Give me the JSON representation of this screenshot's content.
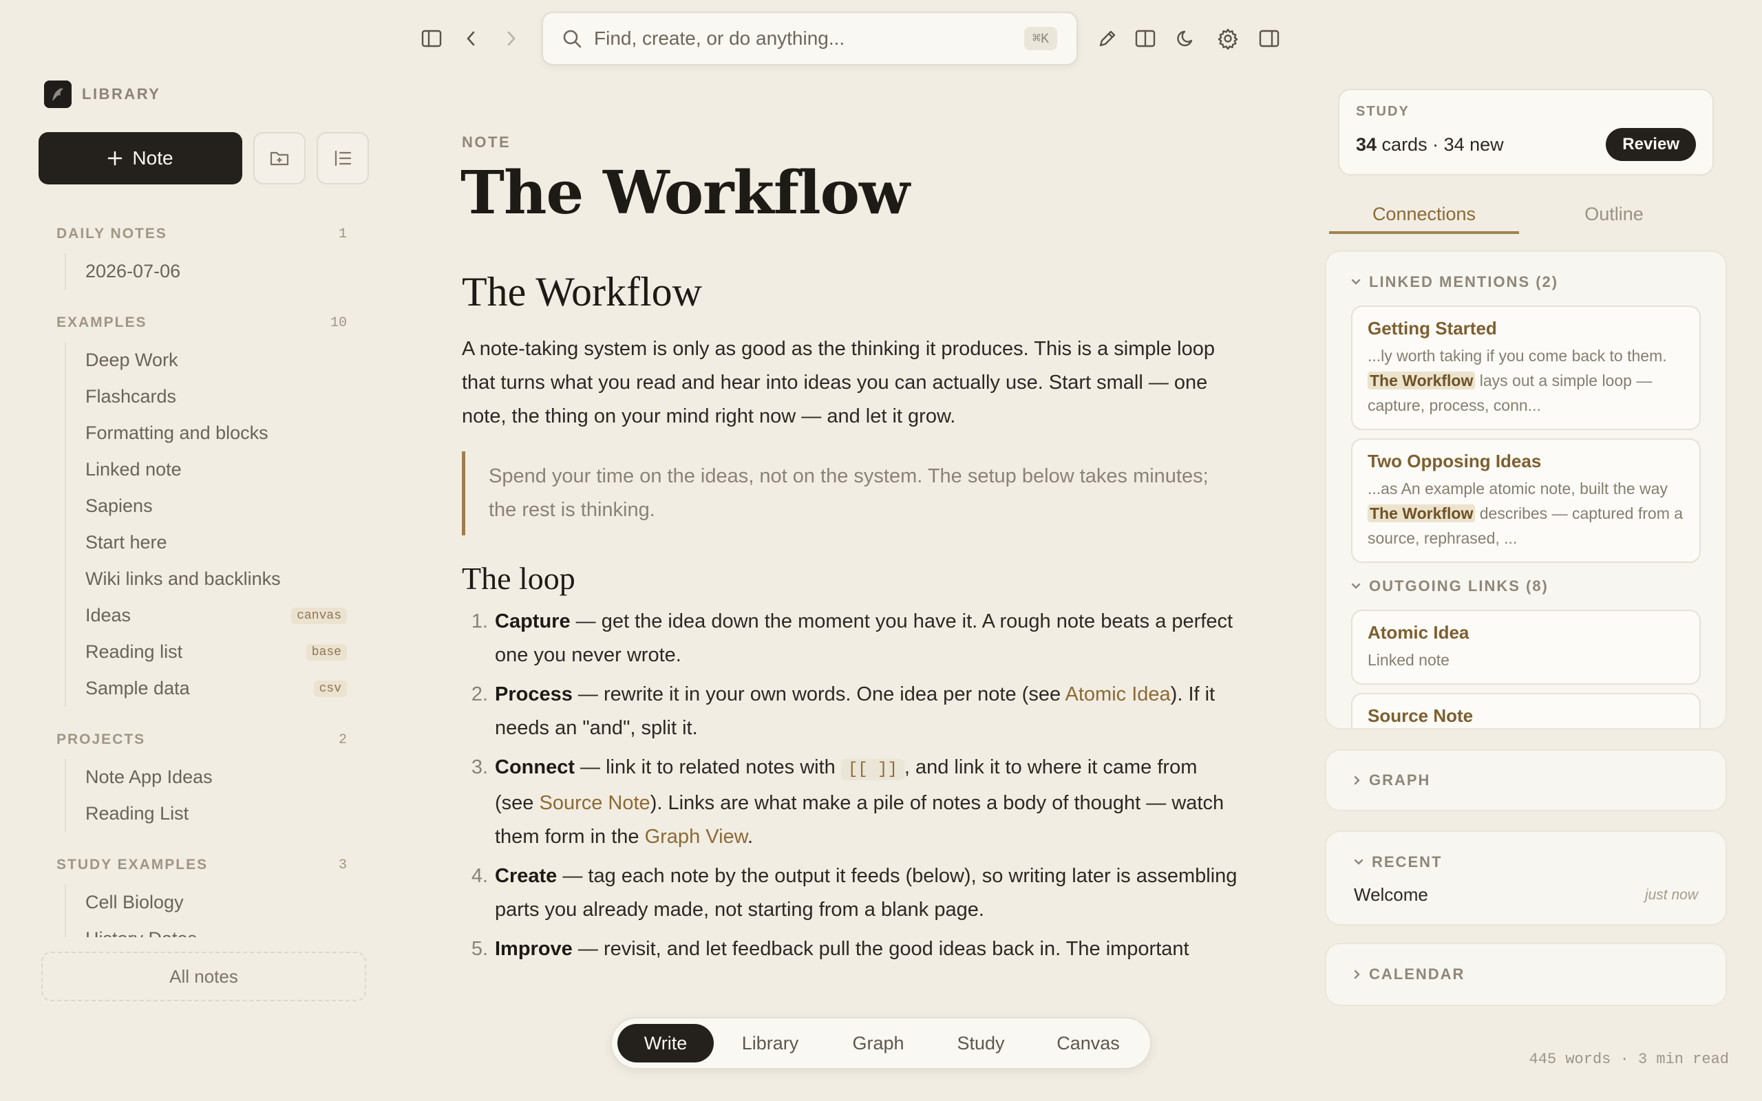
{
  "toolbar": {
    "search_placeholder": "Find, create, or do anything...",
    "search_shortcut": "⌘K",
    "icons": [
      "sidebar-toggle-icon",
      "back-arrow-icon",
      "forward-arrow-icon",
      "pencil-icon",
      "split-view-icon",
      "moon-icon",
      "gear-icon",
      "right-panel-icon"
    ]
  },
  "sidebar": {
    "title": "LIBRARY",
    "new_note_label": "Note",
    "sections": [
      {
        "title": "DAILY NOTES",
        "count": "1",
        "items": [
          {
            "label": "2026-07-06",
            "badge": ""
          }
        ]
      },
      {
        "title": "EXAMPLES",
        "count": "10",
        "items": [
          {
            "label": "Deep Work",
            "badge": ""
          },
          {
            "label": "Flashcards",
            "badge": ""
          },
          {
            "label": "Formatting and blocks",
            "badge": ""
          },
          {
            "label": "Linked note",
            "badge": ""
          },
          {
            "label": "Sapiens",
            "badge": ""
          },
          {
            "label": "Start here",
            "badge": ""
          },
          {
            "label": "Wiki links and backlinks",
            "badge": ""
          },
          {
            "label": "Ideas",
            "badge": "canvas"
          },
          {
            "label": "Reading list",
            "badge": "base"
          },
          {
            "label": "Sample data",
            "badge": "csv"
          }
        ]
      },
      {
        "title": "PROJECTS",
        "count": "2",
        "items": [
          {
            "label": "Note App Ideas",
            "badge": ""
          },
          {
            "label": "Reading List",
            "badge": ""
          }
        ]
      },
      {
        "title": "STUDY EXAMPLES",
        "count": "3",
        "items": [
          {
            "label": "Cell Biology",
            "badge": ""
          },
          {
            "label": "History Dates",
            "badge": ""
          }
        ]
      }
    ],
    "all_notes_label": "All notes"
  },
  "note": {
    "kind_label": "NOTE",
    "title": "The Workflow",
    "h2": "The Workflow",
    "intro": "A note-taking system is only as good as the thinking it produces. This is a simple loop that turns what you read and hear into ideas you can actually use. Start small — one note, the thing on your mind right now — and let it grow.",
    "quote": "Spend your time on the ideas, not on the system. The setup below takes minutes; the rest is thinking.",
    "h3": "The loop",
    "steps": {
      "s1": {
        "num": "1.",
        "term": "Capture",
        "text": " — get the idea down the moment you have it. A rough note beats a perfect one you never wrote."
      },
      "s2": {
        "num": "2.",
        "term": "Process",
        "text_a": " — rewrite it in your own words. One idea per note (see ",
        "link": "Atomic Idea",
        "text_b": "). If it needs an \"and\", split it."
      },
      "s3": {
        "num": "3.",
        "term": "Connect",
        "text_a": " — link it to related notes with ",
        "code": "[[ ]]",
        "text_b": ", and link it to where it came from (see ",
        "link1": "Source Note",
        "text_c": "). Links are what make a pile of notes a body of thought — watch them form in the ",
        "link2": "Graph View",
        "text_d": "."
      },
      "s4": {
        "num": "4.",
        "term": "Create",
        "text": " — tag each note by the output it feeds (below), so writing later is assembling parts you already made, not starting from a blank page."
      },
      "s5": {
        "num": "5.",
        "term": "Improve",
        "text": " — revisit, and let feedback pull the good ideas back in. The important"
      }
    }
  },
  "bottom_tabs": [
    "Write",
    "Library",
    "Graph",
    "Study",
    "Canvas"
  ],
  "bottom_tabs_active": "Write",
  "right": {
    "study": {
      "label": "STUDY",
      "cards": "34",
      "cards_word": " cards",
      "sep": " · ",
      "new_text": "34 new",
      "review_label": "Review"
    },
    "tabs": [
      "Connections",
      "Outline"
    ],
    "linked_mentions": {
      "title": "LINKED MENTIONS (2)",
      "items": [
        {
          "title": "Getting Started",
          "before": "...ly worth taking if you come back to them. ",
          "highlight": "The Workflow",
          "after": " lays out a simple loop — capture, process, conn..."
        },
        {
          "title": "Two Opposing Ideas",
          "before": "...as An example atomic note, built the way ",
          "highlight": "The Workflow",
          "after": " describes — captured from a source, rephrased, ..."
        }
      ]
    },
    "outgoing_links": {
      "title": "OUTGOING LINKS (8)",
      "items": [
        {
          "title": "Atomic Idea",
          "subtitle": "Linked note"
        },
        {
          "title": "Source Note",
          "subtitle": ""
        }
      ]
    },
    "graph_label": "GRAPH",
    "recent": {
      "title": "RECENT",
      "item": "Welcome",
      "time": "just now"
    },
    "calendar_label": "CALENDAR"
  },
  "status": {
    "word_count": "445 words · 3 min read"
  }
}
